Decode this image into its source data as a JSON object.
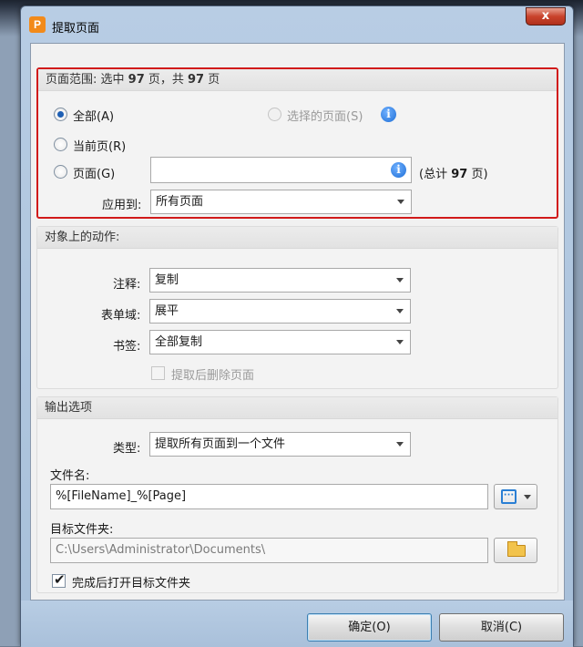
{
  "window": {
    "title": "提取页面",
    "close_glyph": "x"
  },
  "page_range": {
    "header_prefix": "页面范围: 选中 ",
    "selected_count": "97",
    "header_mid": " 页，共 ",
    "total_count": "97",
    "header_suffix": " 页",
    "radio_all": "全部(A)",
    "radio_current": "当前页(R)",
    "radio_pages": "页面(G)",
    "radio_selected": "选择的页面(S)",
    "pages_value": "",
    "total_prefix": "(总计 ",
    "total_pages": "97",
    "total_suffix": " 页)",
    "apply_label": "应用到:",
    "apply_value": "所有页面"
  },
  "actions": {
    "header": "对象上的动作:",
    "annot_label": "注释:",
    "annot_value": "复制",
    "form_label": "表单域:",
    "form_value": "展平",
    "bookmark_label": "书签:",
    "bookmark_value": "全部复制",
    "delete_label": "提取后删除页面"
  },
  "output": {
    "header": "输出选项",
    "type_label": "类型:",
    "type_value": "提取所有页面到一个文件",
    "filename_label": "文件名:",
    "filename_value": "%[FileName]_%[Page]",
    "folder_label": "目标文件夹:",
    "folder_value": "C:\\Users\\Administrator\\Documents\\",
    "open_after_label": "完成后打开目标文件夹",
    "open_after_checked": true
  },
  "buttons": {
    "ok": "确定(O)",
    "cancel": "取消(C)"
  },
  "colors": {
    "highlight_border": "#d11a1a",
    "accent_blue": "#1f6fd6",
    "app_icon": "#f28a1a"
  }
}
